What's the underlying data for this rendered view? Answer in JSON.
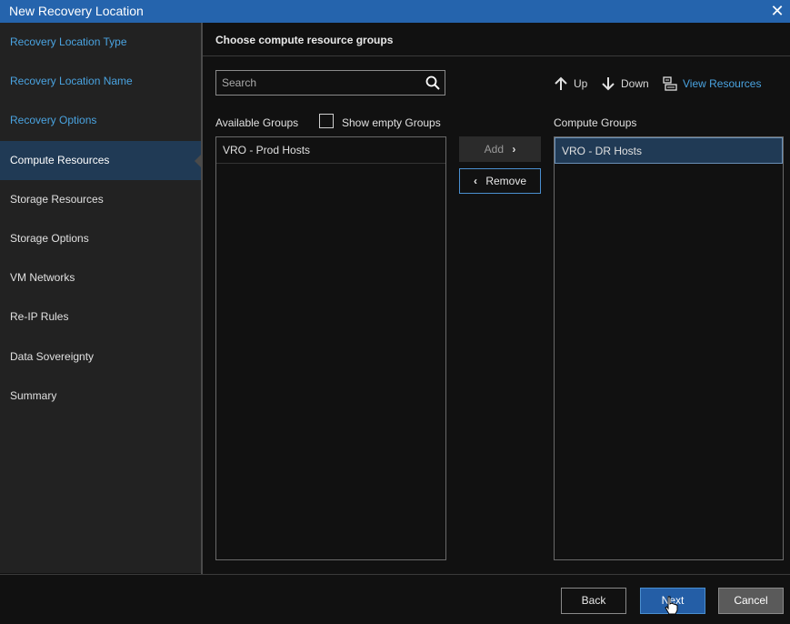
{
  "window": {
    "title": "New Recovery Location",
    "close_icon": "close-icon"
  },
  "sidebar": {
    "items": [
      {
        "label": "Recovery Location Type",
        "state": "done"
      },
      {
        "label": "Recovery Location Name",
        "state": "done"
      },
      {
        "label": "Recovery Options",
        "state": "done"
      },
      {
        "label": "Compute Resources",
        "state": "active"
      },
      {
        "label": "Storage Resources",
        "state": "pending"
      },
      {
        "label": "Storage Options",
        "state": "pending"
      },
      {
        "label": "VM Networks",
        "state": "pending"
      },
      {
        "label": "Re-IP Rules",
        "state": "pending"
      },
      {
        "label": "Data Sovereignty",
        "state": "pending"
      },
      {
        "label": "Summary",
        "state": "pending"
      }
    ]
  },
  "main": {
    "heading": "Choose compute resource groups",
    "search": {
      "placeholder": "Search",
      "value": ""
    },
    "available": {
      "label": "Available Groups",
      "show_empty_label": "Show empty Groups",
      "show_empty_checked": false,
      "items": [
        "VRO - Prod Hosts"
      ]
    },
    "compute": {
      "label": "Compute Groups",
      "items": [
        "VRO - DR Hosts"
      ],
      "selected_index": 0
    },
    "buttons": {
      "add": "Add",
      "remove": "Remove"
    },
    "toolbar": {
      "up": "Up",
      "down": "Down",
      "view_resources": "View Resources"
    }
  },
  "footer": {
    "back": "Back",
    "next": "Next",
    "cancel": "Cancel"
  },
  "colors": {
    "accent": "#2564ad",
    "link": "#4aa3e0",
    "selected_bg": "#203a55"
  }
}
